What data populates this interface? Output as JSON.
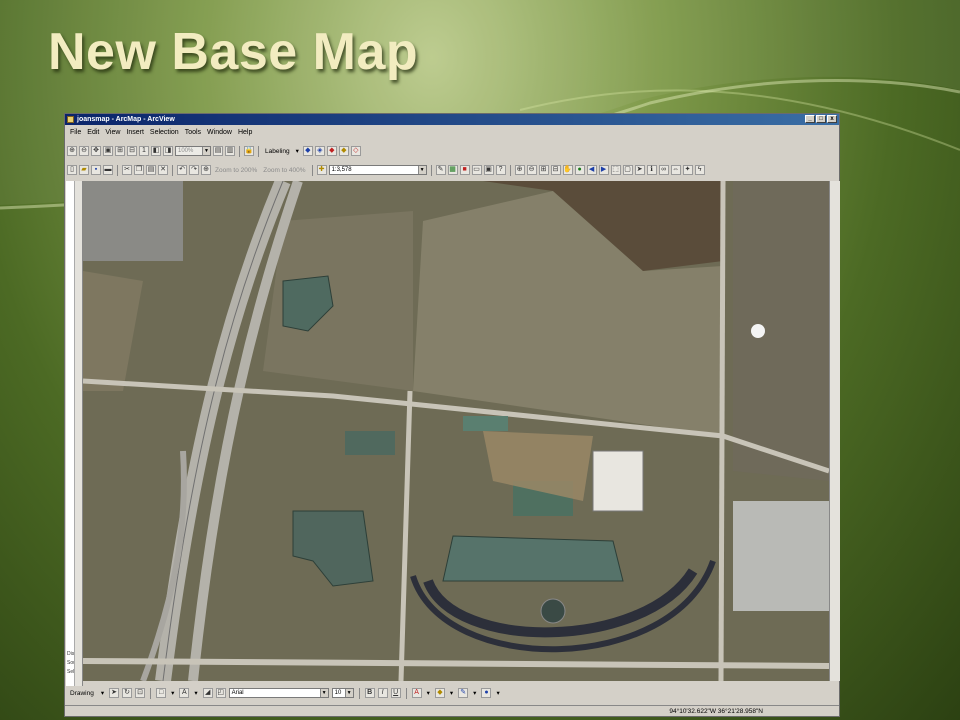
{
  "slide": {
    "title": "New Base Map"
  },
  "window": {
    "title": "joansmap - ArcMap - ArcView",
    "controls": {
      "minimize": "_",
      "maximize": "□",
      "close": "x"
    }
  },
  "menubar": {
    "items": [
      {
        "label": "File"
      },
      {
        "label": "Edit"
      },
      {
        "label": "View"
      },
      {
        "label": "Insert"
      },
      {
        "label": "Selection"
      },
      {
        "label": "Tools"
      },
      {
        "label": "Window"
      },
      {
        "label": "Help"
      }
    ]
  },
  "toolbar1": {
    "zoom_percent": "100%",
    "labeling_label": "Labeling"
  },
  "toolbar2": {
    "zoom_to_200": "Zoom to 200%",
    "zoom_to_400": "Zoom to 400%",
    "map_scale": "1:3,578"
  },
  "drawing_toolbar": {
    "drawing_label": "Drawing",
    "font_name": "Arial",
    "font_size": "10",
    "bold": "B",
    "italic": "I",
    "underline": "U"
  },
  "left_panel": {
    "labels": [
      "Disp",
      "Sour",
      "Selec"
    ]
  },
  "status_bar": {
    "coordinates": "94°10'32.622\"W  36°21'28.958\"N"
  },
  "colors": {
    "titlebar": "#0a246a",
    "window_face": "#d4d0c8",
    "slide_title": "#f2ecc0"
  }
}
